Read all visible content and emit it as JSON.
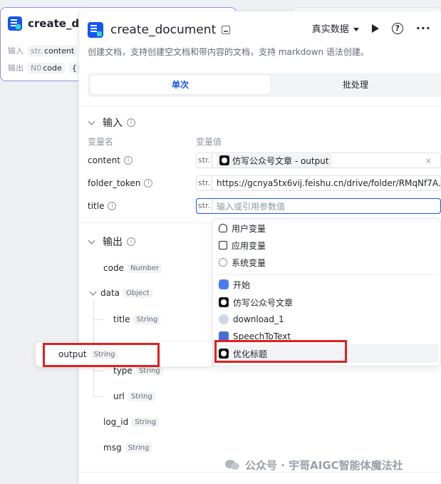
{
  "bg_node": {
    "title": "create_doc",
    "input_label": "输入",
    "input_type": "str.",
    "input_value": "content",
    "output_label": "输出",
    "output_type": "N0",
    "output_value": "code",
    "output_extra": "{ }"
  },
  "panel": {
    "title": "create_document",
    "data_mode": "真实数据",
    "description": "创建文档，支持创建空文档和带内容的文档，支持 markdown 语法创建。",
    "tabs": [
      "单次",
      "批处理"
    ]
  },
  "input_section": {
    "title": "输入",
    "col_name": "变量名",
    "col_value": "变量值",
    "rows": [
      {
        "name": "content",
        "type": "str.",
        "value": "仿写公众号文章 - output"
      },
      {
        "name": "folder_token",
        "type": "str.",
        "value": "https://gcnya5tx6vij.feishu.cn/drive/folder/RMqNf7A..."
      },
      {
        "name": "title",
        "type": "str.",
        "placeholder": "输入或引用参数值"
      }
    ],
    "clear": "×"
  },
  "output_section": {
    "title": "输出",
    "items": [
      {
        "name": "code",
        "type": "Number"
      },
      {
        "name": "data",
        "type": "Object"
      },
      {
        "name": "title",
        "type": "String"
      },
      {
        "name": "type",
        "type": "String"
      },
      {
        "name": "url",
        "type": "String"
      },
      {
        "name": "log_id",
        "type": "String"
      },
      {
        "name": "msg",
        "type": "String"
      }
    ]
  },
  "dropdown": {
    "groups": [
      "用户变量",
      "应用变量",
      "系统变量"
    ],
    "nodes": [
      "开始",
      "仿写公众号文章",
      "download_1",
      "SpeechToText",
      "优化标题"
    ]
  },
  "ghost": {
    "name": "output",
    "type": "String"
  },
  "watermark": "公众号 · 宇哥AIGC智能体魔法社"
}
